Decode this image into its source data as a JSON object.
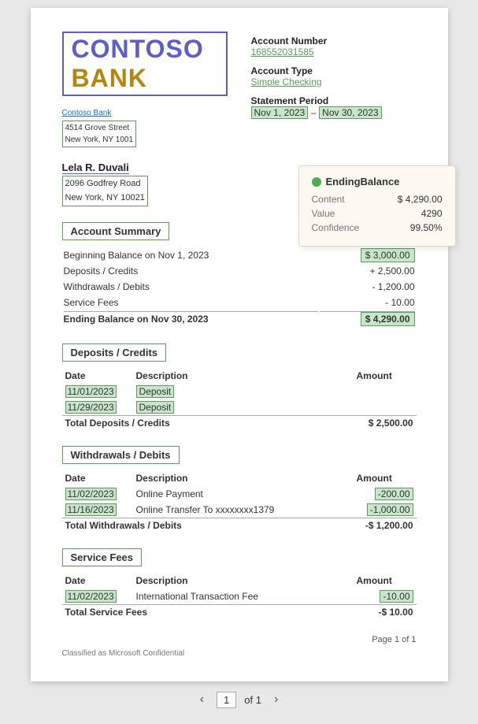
{
  "logo": {
    "part1": "CONTOSO",
    "part2": "BANK"
  },
  "bank": {
    "name": "Contoso Bank",
    "address_line1": "4514 Grove Street",
    "address_line2": "New York, NY 1001"
  },
  "account": {
    "number_label": "Account Number",
    "number_value": "168552031585",
    "type_label": "Account Type",
    "type_value": "Simple Checking",
    "period_label": "Statement Period",
    "period_start": "Nov 1, 2023",
    "period_dash": "–",
    "period_end": "Nov 30, 2023"
  },
  "customer": {
    "name": "Lela R. Duvali",
    "address_line1": "2096 Godfrey Road",
    "address_line2": "New York, NY 10021"
  },
  "account_summary": {
    "section_label": "Account Summary",
    "rows": [
      {
        "label": "Beginning Balance on Nov 1, 2023",
        "value": "$ 3,000.00"
      },
      {
        "label": "Deposits / Credits",
        "value": "+ 2,500.00"
      },
      {
        "label": "Withdrawals / Debits",
        "value": "- 1,200.00"
      },
      {
        "label": "Service Fees",
        "value": "- 10.00"
      }
    ],
    "ending_label": "Ending Balance on Nov 30, 2023",
    "ending_value": "$ 4,290.00"
  },
  "deposits": {
    "section_label": "Deposits / Credits",
    "col_date": "Date",
    "col_desc": "Description",
    "col_amount": "Amount",
    "rows": [
      {
        "date": "11/01/2023",
        "description": "Deposit",
        "amount": ""
      },
      {
        "date": "11/29/2023",
        "description": "Deposit",
        "amount": ""
      }
    ],
    "total_label": "Total Deposits / Credits",
    "total_amount": "$ 2,500.00"
  },
  "withdrawals": {
    "section_label": "Withdrawals / Debits",
    "col_date": "Date",
    "col_desc": "Description",
    "col_amount": "Amount",
    "rows": [
      {
        "date": "11/02/2023",
        "description": "Online Payment",
        "amount": "-200.00"
      },
      {
        "date": "11/16/2023",
        "description": "Online Transfer To xxxxxxxx1379",
        "amount": "-1,000.00"
      }
    ],
    "total_label": "Total Withdrawals / Debits",
    "total_amount": "-$ 1,200.00"
  },
  "service_fees": {
    "section_label": "Service Fees",
    "col_date": "Date",
    "col_desc": "Description",
    "col_amount": "Amount",
    "rows": [
      {
        "date": "11/02/2023",
        "description": "International Transaction Fee",
        "amount": "-10.00"
      }
    ],
    "total_label": "Total Service Fees",
    "total_amount": "-$ 10.00"
  },
  "tooltip": {
    "title": "EndingBalance",
    "dot_color": "#4caf50",
    "content_label": "Content",
    "content_value": "$ 4,290.00",
    "value_label": "Value",
    "value_value": "4290",
    "confidence_label": "Confidence",
    "confidence_value": "99.50%"
  },
  "footer": {
    "page_text": "Page 1 of 1",
    "confidential": "Classified as Microsoft Confidential"
  },
  "pagination": {
    "prev": "‹",
    "current": "1",
    "of_text": "of 1",
    "next": "›"
  }
}
